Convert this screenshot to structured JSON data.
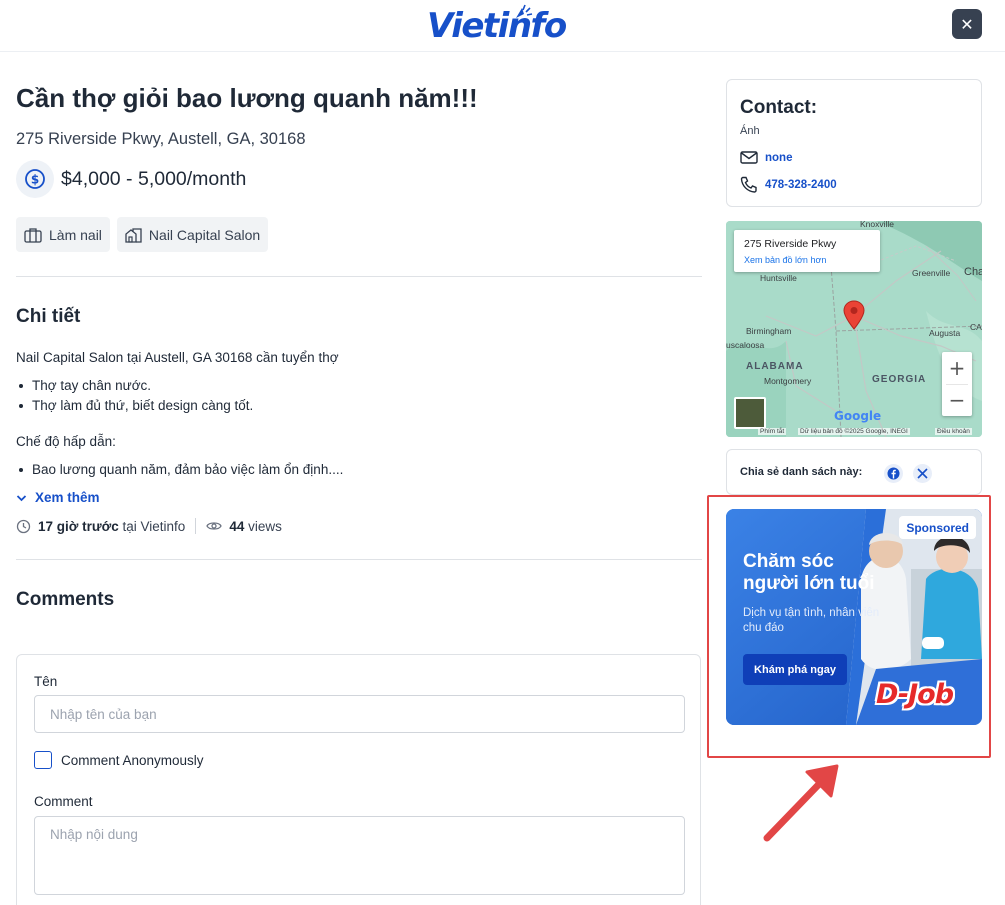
{
  "header": {
    "logo_text": "Vietinfo",
    "close_label": "✕"
  },
  "job": {
    "title": "Cần thợ giỏi bao lương quanh năm!!!",
    "address": "275 Riverside Pkwy, Austell, GA, 30168",
    "salary": "$4,000 - 5,000/month",
    "tags": [
      "Làm nail",
      "Nail Capital Salon"
    ]
  },
  "details": {
    "heading": "Chi tiết",
    "intro": "Nail Capital Salon tại Austell, GA 30168 cần tuyển thợ",
    "bullets": [
      "Thợ tay chân nước.",
      "Thợ làm đủ thứ, biết design càng tốt."
    ],
    "benefits_heading": "Chế độ hấp dẫn:",
    "benefits": [
      "Bao lương quanh năm, đảm bảo việc làm ổn định...."
    ],
    "see_more": "Xem thêm",
    "posted_time": "17 giờ trước",
    "posted_at": "tại Vietinfo",
    "views_count": "44",
    "views_label": "views"
  },
  "comments": {
    "heading": "Comments",
    "name_label": "Tên",
    "name_placeholder": "Nhập tên của bạn",
    "anonymous_label": "Comment Anonymously",
    "comment_label": "Comment",
    "comment_placeholder": "Nhập nội dung"
  },
  "contact": {
    "heading": "Contact:",
    "name": "Ánh",
    "email": "none",
    "phone": "478-328-2400"
  },
  "map": {
    "popup_title": "275 Riverside Pkwy",
    "popup_link": "Xem bản đồ lớn hơn",
    "labels": {
      "knoxville": "Knoxville",
      "huntsville": "Huntsville",
      "greenville": "Greenville",
      "cha": "Cha",
      "birmingham": "Birmingham",
      "tuscaloosa": "uscaloosa",
      "alabama": "ALABAMA",
      "montgomery": "Montgomery",
      "georgia": "GEORGIA",
      "augusta": "Augusta",
      "ca": "CA"
    },
    "google": "Google",
    "footer_shortcuts": "Phím tắt",
    "footer_data": "Dữ liệu bản đồ ©2025 Google, INEGI",
    "footer_terms": "Điều khoản",
    "zoom_in": "+",
    "zoom_out": "−"
  },
  "share": {
    "label": "Chia sẻ danh sách này:"
  },
  "ad": {
    "badge": "Sponsored",
    "headline": "Chăm sóc người lớn tuổi",
    "subline": "Dịch vụ tận tình, nhân viên chu đáo",
    "cta": "Khám phá ngay",
    "brand": "D-Job"
  },
  "colors": {
    "brand_blue": "#1750c9",
    "highlight_red": "#e24646"
  }
}
